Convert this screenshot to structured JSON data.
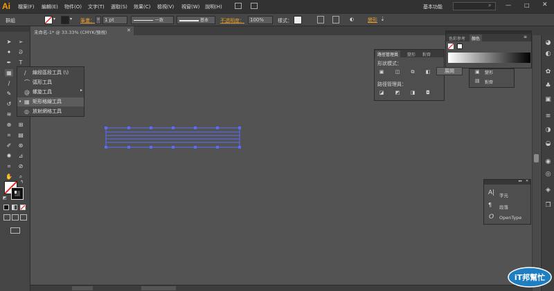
{
  "app": {
    "logo": "Ai",
    "workspace": "基本功能"
  },
  "menus": [
    "檔案(F)",
    "編輯(E)",
    "物件(O)",
    "文字(T)",
    "選取(S)",
    "效果(C)",
    "檢視(V)",
    "視窗(W)",
    "說明(H)"
  ],
  "control": {
    "selection": "群組",
    "stroke_label": "筆畫：",
    "stroke_value": "1 pt",
    "line_style": "一致",
    "brush": "基本",
    "opacity_label": "不透明度：",
    "opacity_value": "100%",
    "style_label": "樣式："
  },
  "document": {
    "tab": "未命名-1* @ 33.33% (CMYK/預視)"
  },
  "flyout": [
    {
      "label": "線段區段工具 (\\)",
      "icon": "line-segment-icon"
    },
    {
      "label": "弧形工具",
      "icon": "arc-icon"
    },
    {
      "label": "螺旋工具",
      "icon": "spiral-icon"
    },
    {
      "label": "矩形格線工具",
      "icon": "rect-grid-icon",
      "selected": true
    },
    {
      "label": "放射網格工具",
      "icon": "polar-grid-icon"
    }
  ],
  "pathfinder": {
    "tabs": [
      "路徑管理員",
      "變形",
      "對齊"
    ],
    "shape_modes_label": "形狀模式：",
    "expand_button": "展開",
    "pathfinders_label": "路徑管理員："
  },
  "color_panel": {
    "tabs": [
      "色彩參考",
      "顏色"
    ]
  },
  "transform_panel": {
    "items": [
      "變形",
      "對齊"
    ]
  },
  "type_panel": {
    "items": [
      "字元",
      "段落",
      "OpenType"
    ]
  },
  "colors": {
    "accent": "#ff9a00",
    "grid_line": "#5a6cff",
    "canvas": "#535353"
  },
  "watermark": {
    "text": "iT邦幫忙"
  }
}
